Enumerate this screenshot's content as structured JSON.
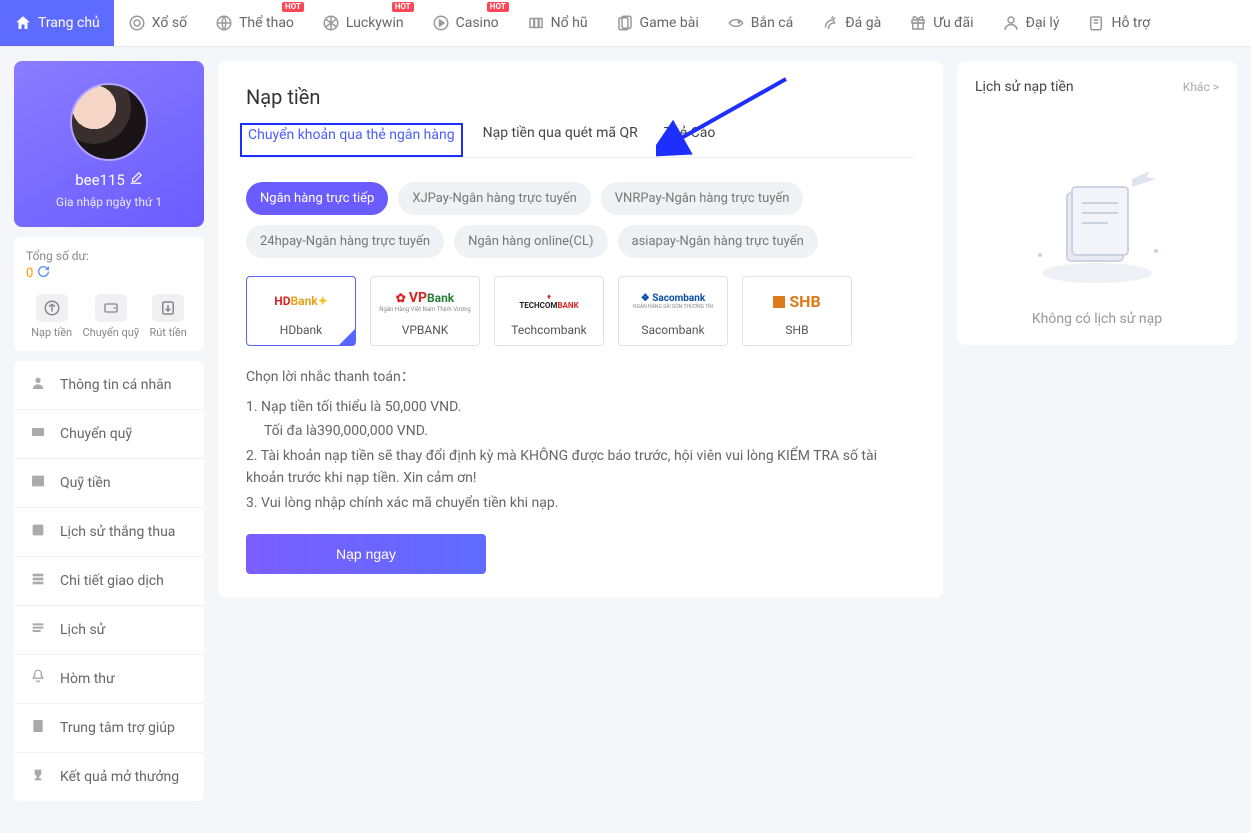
{
  "topnav": [
    {
      "label": "Trang chủ",
      "active": true,
      "icon": "home"
    },
    {
      "label": "Xổ số",
      "icon": "target"
    },
    {
      "label": "Thể thao",
      "icon": "sports",
      "hot": true
    },
    {
      "label": "Luckywin",
      "icon": "ball",
      "hot": true
    },
    {
      "label": "Casino",
      "icon": "play",
      "hot": true
    },
    {
      "label": "Nổ hũ",
      "icon": "slot"
    },
    {
      "label": "Game bài",
      "icon": "card"
    },
    {
      "label": "Bắn cá",
      "icon": "fish"
    },
    {
      "label": "Đá gà",
      "icon": "rooster"
    },
    {
      "label": "Ưu đãi",
      "icon": "gift"
    },
    {
      "label": "Đại lý",
      "icon": "user"
    },
    {
      "label": "Hỗ trợ",
      "icon": "help"
    }
  ],
  "hot_label": "HOT",
  "profile": {
    "username": "bee115",
    "membership": "Gia nhập ngày thứ 1"
  },
  "balance": {
    "label": "Tổng số dư:",
    "value": "0"
  },
  "wallet_actions": [
    {
      "label": "Nạp tiền"
    },
    {
      "label": "Chuyển quỹ"
    },
    {
      "label": "Rút tiền"
    }
  ],
  "sidebar_menu": [
    {
      "label": "Thông tin cá nhân"
    },
    {
      "label": "Chuyển quỹ"
    },
    {
      "label": "Quỹ tiền"
    },
    {
      "label": "Lịch sử thắng thua"
    },
    {
      "label": "Chi tiết giao dịch"
    },
    {
      "label": "Lịch sử"
    },
    {
      "label": "Hòm thư"
    },
    {
      "label": "Trung tâm trợ giúp"
    },
    {
      "label": "Kết quả mở thưởng"
    }
  ],
  "main": {
    "title": "Nạp tiền",
    "tabs": [
      {
        "label": "Chuyển khoản qua thẻ ngân hàng",
        "active": true
      },
      {
        "label": "Nạp tiền qua quét mã QR"
      },
      {
        "label": "Thẻ Cào"
      }
    ],
    "methods": [
      {
        "label": "Ngân hàng trực tiếp",
        "active": true
      },
      {
        "label": "XJPay-Ngân hàng trực tuyến"
      },
      {
        "label": "VNRPay-Ngân hàng trực tuyến"
      },
      {
        "label": "24hpay-Ngân hàng trực tuyến"
      },
      {
        "label": "Ngân hàng online(CL)"
      },
      {
        "label": "asiapay-Ngân hàng trực tuyến"
      }
    ],
    "banks": [
      {
        "name": "HDbank",
        "logo": "hd",
        "selected": true
      },
      {
        "name": "VPBANK",
        "logo": "vp"
      },
      {
        "name": "Techcombank",
        "logo": "tcb"
      },
      {
        "name": "Sacombank",
        "logo": "scb"
      },
      {
        "name": "SHB",
        "logo": "shb"
      }
    ],
    "notice_title": "Chọn lời nhắc thanh toán：",
    "notices": [
      "1. Nạp tiền tối thiểu là 50,000 VND.",
      "    Tối đa là390,000,000 VND.",
      "2. Tài khoản nạp tiền sẽ thay đổi định kỳ mà KHÔNG được báo trước, hội viên vui lòng KIỂM TRA số tài khoản trước khi nạp tiền. Xin cảm ơn!",
      "3. Vui lòng nhập chính xác mã chuyển tiền khi nạp."
    ],
    "deposit_button": "Nạp ngay"
  },
  "right": {
    "title": "Lịch sử nạp tiền",
    "more": "Khác >",
    "empty": "Không có lịch sử nạp"
  }
}
